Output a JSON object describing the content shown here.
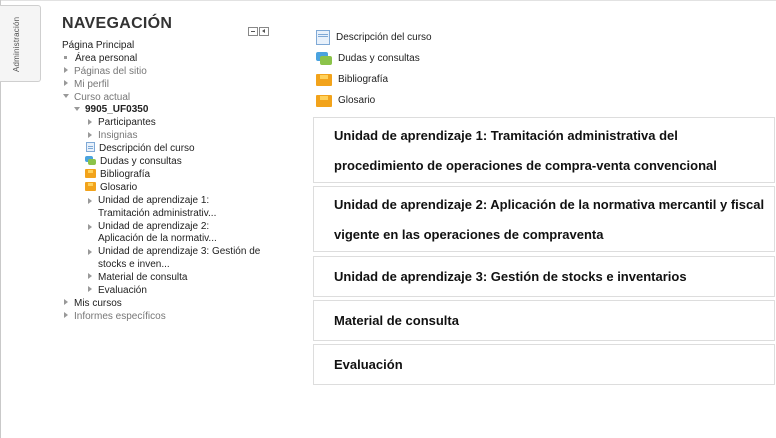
{
  "admin_tab": {
    "label": "Administración"
  },
  "navigation": {
    "title": "NAVEGACIÓN",
    "items": {
      "home": "Página Principal",
      "personal_area": "Área personal",
      "site_pages": "Páginas del sitio",
      "my_profile": "Mi perfil",
      "current_course": "Curso actual",
      "course_code": "9905_UF0350",
      "participants": "Participantes",
      "badges": "Insignias",
      "course_description": "Descripción del curso",
      "questions": "Dudas y consultas",
      "bibliography": "Bibliografía",
      "glossary": "Glosario",
      "unit1": "Unidad de aprendizaje 1: Tramitación administrativ...",
      "unit2": "Unidad de aprendizaje 2: Aplicación de la normativ...",
      "unit3": "Unidad de aprendizaje 3: Gestión de stocks e inven...",
      "reference_material": "Material de consulta",
      "evaluation": "Evaluación",
      "my_courses": "Mis cursos",
      "specific_reports": "Informes específicos"
    }
  },
  "activities": [
    {
      "label": "Descripción del curso",
      "icon": "page-icon"
    },
    {
      "label": "Dudas y consultas",
      "icon": "forum-icon"
    },
    {
      "label": "Bibliografía",
      "icon": "folder-icon"
    },
    {
      "label": "Glosario",
      "icon": "folder-icon"
    }
  ],
  "sections": [
    {
      "title": "Unidad de aprendizaje 1: Tramitación administrativa del procedimiento de operaciones de compra-venta convencional"
    },
    {
      "title": "Unidad de aprendizaje 2: Aplicación de la normativa mercantil y fiscal vigente en las operaciones de compraventa"
    },
    {
      "title": "Unidad de aprendizaje 3: Gestión de stocks e inventarios"
    },
    {
      "title": "Material de consulta"
    },
    {
      "title": "Evaluación"
    }
  ],
  "colors": {
    "folder": "#f2a31b",
    "forum_blue": "#4aa3df",
    "forum_green": "#8bc34a",
    "page": "#7fa9d6",
    "border": "#dddddd"
  }
}
